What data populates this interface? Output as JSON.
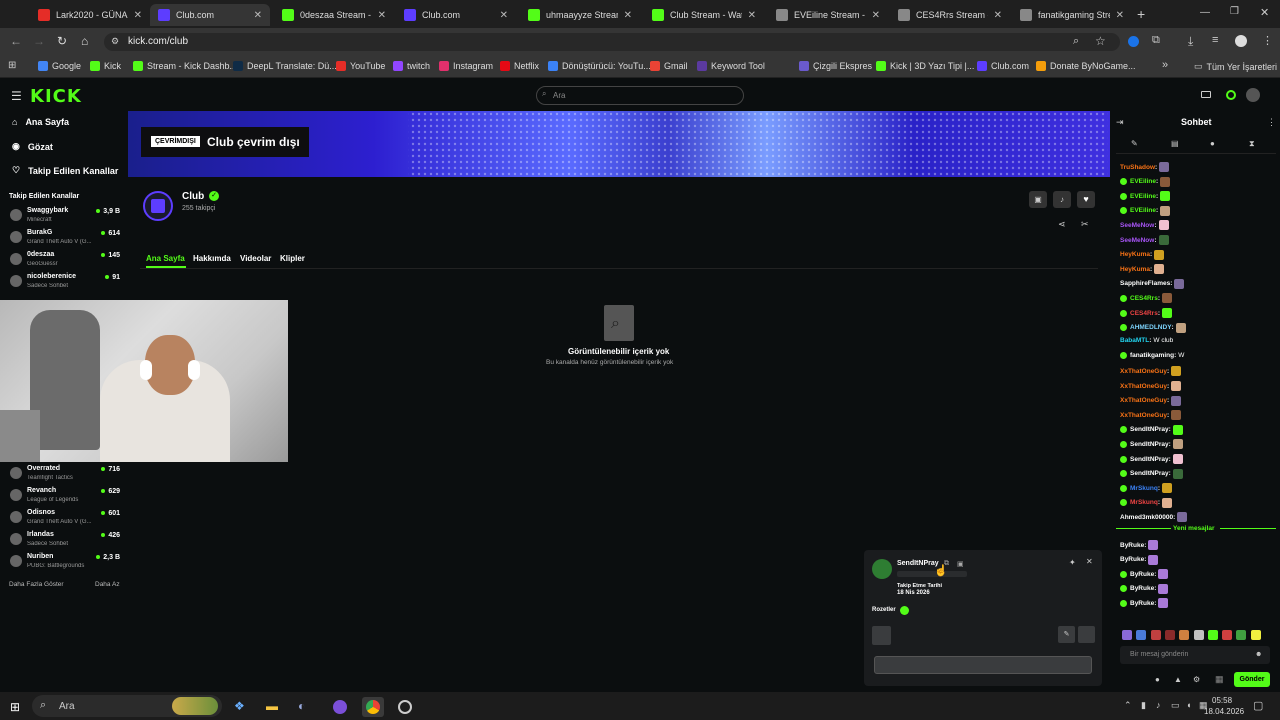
{
  "browser": {
    "tabs": [
      {
        "label": "Lark2020 - GÜNA",
        "color": "#e52d27",
        "active": false
      },
      {
        "label": "Club.com",
        "color": "#5d3dff",
        "active": true
      },
      {
        "label": "0deszaa Stream - Wa",
        "color": "#53fc18",
        "active": false
      },
      {
        "label": "Club.com",
        "color": "#5d3dff",
        "active": false
      },
      {
        "label": "uhmaayyze Stream -",
        "color": "#53fc18",
        "active": false
      },
      {
        "label": "Club Stream - Watch",
        "color": "#53fc18",
        "active": false
      },
      {
        "label": "EVEiline Stream - Wa",
        "color": "#888888",
        "active": false
      },
      {
        "label": "CES4Rrs Stream - Wa",
        "color": "#888888",
        "active": false
      },
      {
        "label": "fanatikgaming Strea",
        "color": "#888888",
        "active": false
      }
    ],
    "url": "kick.com/club",
    "bookmarks": [
      {
        "label": "Google",
        "color": "#4285f4"
      },
      {
        "label": "Kick",
        "color": "#53fc18"
      },
      {
        "label": "Stream - Kick Dashb...",
        "color": "#53fc18"
      },
      {
        "label": "DeepL Translate: Dü...",
        "color": "#0f2b46"
      },
      {
        "label": "YouTube",
        "color": "#e52d27"
      },
      {
        "label": "twitch",
        "color": "#9146ff"
      },
      {
        "label": "Instagram",
        "color": "#e1306c"
      },
      {
        "label": "Netflix",
        "color": "#e50914"
      },
      {
        "label": "Dönüştürücü: YouTu...",
        "color": "#3b82f6"
      },
      {
        "label": "Gmail",
        "color": "#ea4335"
      },
      {
        "label": "Keyword Tool",
        "color": "#5b3aa0"
      },
      {
        "label": "Çizgili Ekspres",
        "color": "#6a5acd"
      },
      {
        "label": "Kick | 3D Yazı Tipi |...",
        "color": "#53fc18"
      },
      {
        "label": "Club.com",
        "color": "#5d3dff"
      },
      {
        "label": "Donate ByNoGame...",
        "color": "#f59e0b"
      }
    ],
    "all_bookmarks": "Tüm Yer İşaretleri"
  },
  "kick": {
    "logo": "KICK",
    "search_placeholder": "Ara",
    "nav": [
      "Ana Sayfa",
      "Gözat",
      "Takip Edilen Kanallar"
    ],
    "followed_title": "Takip Edilen Kanallar",
    "followed": [
      {
        "name": "Swaggybark",
        "game": "Minecraft",
        "viewers": "3,9 B"
      },
      {
        "name": "BurakG",
        "game": "Grand Theft Auto V (G...",
        "viewers": "614"
      },
      {
        "name": "0deszaa",
        "game": "GeoGuessr",
        "viewers": "145"
      },
      {
        "name": "nicoleberenice",
        "game": "Sadece Sohbet",
        "viewers": "91"
      },
      {
        "name": "Overrated",
        "game": "Teamfight Tactics",
        "viewers": "716"
      },
      {
        "name": "Revanch",
        "game": "League of Legends",
        "viewers": "629"
      },
      {
        "name": "Odisnos",
        "game": "Grand Theft Auto V (G...",
        "viewers": "601"
      },
      {
        "name": "Irlandas",
        "game": "Sadece Sohbet",
        "viewers": "426"
      },
      {
        "name": "Nuriben",
        "game": "PUBG: Battlegrounds",
        "viewers": "2,3 B"
      }
    ],
    "show_more": "Daha Fazla Göster",
    "show_less": "Daha Az",
    "offline_badge": "ÇEVRİMDIŞI",
    "offline_title": "Club çevrim dışı",
    "channel_name": "Club",
    "followers": "255 takipçi",
    "channel_tabs": [
      "Ana Sayfa",
      "Hakkımda",
      "Videolar",
      "Klipler"
    ],
    "empty_title": "Görüntülenebilir içerik yok",
    "empty_sub": "Bu kanalda henüz görüntülenebilir içerik yok"
  },
  "chat": {
    "title": "Sohbet",
    "messages": [
      {
        "user": "TruShadow",
        "color": "#f97316",
        "verified": false,
        "text": ""
      },
      {
        "user": "EVEiline",
        "color": "#53fc18",
        "verified": true,
        "text": ""
      },
      {
        "user": "EVEiline",
        "color": "#53fc18",
        "verified": true,
        "text": ""
      },
      {
        "user": "EVEiline",
        "color": "#53fc18",
        "verified": true,
        "text": ""
      },
      {
        "user": "SeeMeNow",
        "color": "#a855f7",
        "verified": false,
        "text": ""
      },
      {
        "user": "SeeMeNow",
        "color": "#a855f7",
        "verified": false,
        "text": ""
      },
      {
        "user": "HeyKuma",
        "color": "#f97316",
        "verified": false,
        "text": ""
      },
      {
        "user": "HeyKuma",
        "color": "#f97316",
        "verified": false,
        "text": ""
      },
      {
        "user": "SapphireFlames",
        "color": "#ffffff",
        "verified": false,
        "text": ""
      },
      {
        "user": "CES4Rrs",
        "color": "#53fc18",
        "verified": true,
        "text": ""
      },
      {
        "user": "CES4Rrs",
        "color": "#ef4444",
        "verified": true,
        "text": ""
      },
      {
        "user": "AHMEDLNDY",
        "color": "#7dd3fc",
        "verified": true,
        "text": ""
      },
      {
        "user": "BabaMTL",
        "color": "#22d3ee",
        "verified": false,
        "text": "W club"
      },
      {
        "user": "fanatikgaming",
        "color": "#ffffff",
        "verified": true,
        "text": "W"
      },
      {
        "user": "XxThatOneGuy",
        "color": "#f97316",
        "verified": false,
        "text": ""
      },
      {
        "user": "XxThatOneGuy",
        "color": "#f97316",
        "verified": false,
        "text": ""
      },
      {
        "user": "XxThatOneGuy",
        "color": "#f97316",
        "verified": false,
        "text": ""
      },
      {
        "user": "XxThatOneGuy",
        "color": "#f97316",
        "verified": false,
        "text": ""
      },
      {
        "user": "SendItNPray",
        "color": "#ffffff",
        "verified": true,
        "text": ""
      },
      {
        "user": "SendItNPray",
        "color": "#ffffff",
        "verified": true,
        "text": ""
      },
      {
        "user": "SendItNPray",
        "color": "#ffffff",
        "verified": true,
        "text": ""
      },
      {
        "user": "SendItNPray",
        "color": "#ffffff",
        "verified": true,
        "text": ""
      },
      {
        "user": "MrSkunq",
        "color": "#3b82f6",
        "verified": true,
        "text": ""
      },
      {
        "user": "MrSkunq",
        "color": "#ef4444",
        "verified": true,
        "text": ""
      },
      {
        "user": "Ahmed3mk00000",
        "color": "#ffffff",
        "verified": false,
        "text": ""
      }
    ],
    "new_messages": "Yeni mesajlar",
    "after": [
      {
        "user": "ByRuke",
        "verified": false
      },
      {
        "user": "ByRuke",
        "verified": false
      },
      {
        "user": "ByRuke",
        "verified": true
      },
      {
        "user": "ByRuke",
        "verified": true
      },
      {
        "user": "ByRuke",
        "verified": true
      }
    ],
    "input_placeholder": "Bir mesaj gönderin",
    "send": "Gönder"
  },
  "popup": {
    "user": "SendItNPray",
    "follow_label": "Takip Etme Tarihi",
    "follow_date": "18 Nis 2026",
    "badges_label": "Rozetler"
  },
  "taskbar": {
    "search": "Ara",
    "time": "05:58",
    "date": "18.04.2026"
  }
}
